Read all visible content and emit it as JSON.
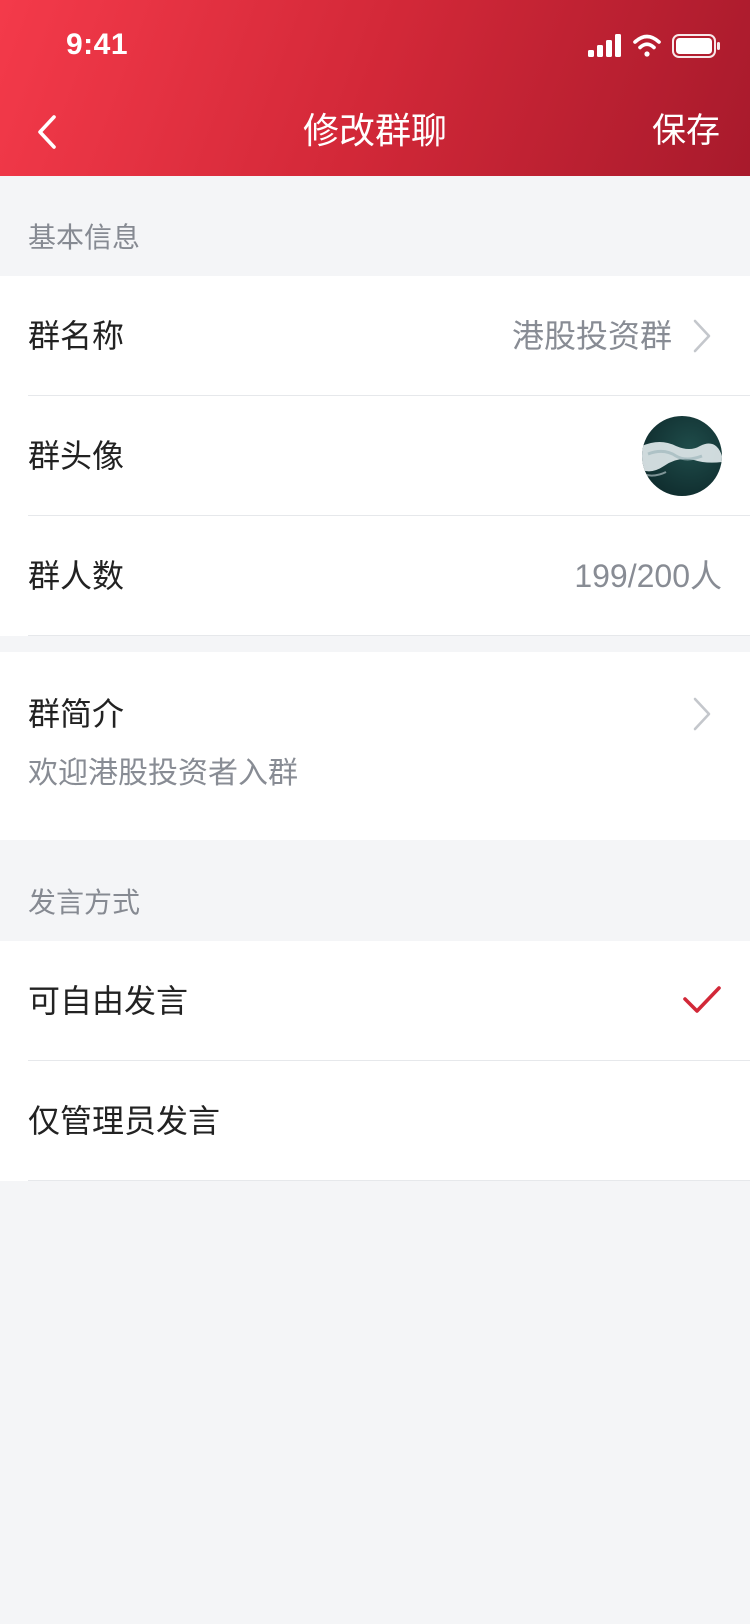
{
  "status_bar": {
    "time": "9:41",
    "icons": [
      "cellular-signal-icon",
      "wifi-icon",
      "battery-icon"
    ]
  },
  "nav": {
    "back_icon": "chevron-left-icon",
    "title": "修改群聊",
    "save_label": "保存"
  },
  "basic_info": {
    "section_label": "基本信息",
    "group_name": {
      "label": "群名称",
      "value": "港股投资群"
    },
    "group_avatar": {
      "label": "群头像"
    },
    "member_count": {
      "label": "群人数",
      "value": "199/200人"
    },
    "intro": {
      "label": "群简介",
      "value": "欢迎港股投资者入群"
    }
  },
  "speak_mode": {
    "section_label": "发言方式",
    "options": [
      {
        "label": "可自由发言",
        "selected": true
      },
      {
        "label": "仅管理员发言",
        "selected": false
      }
    ]
  },
  "colors": {
    "accent": "#d22838",
    "header_start": "#f43a4a",
    "header_end": "#a81a2c",
    "background": "#f4f5f7"
  }
}
